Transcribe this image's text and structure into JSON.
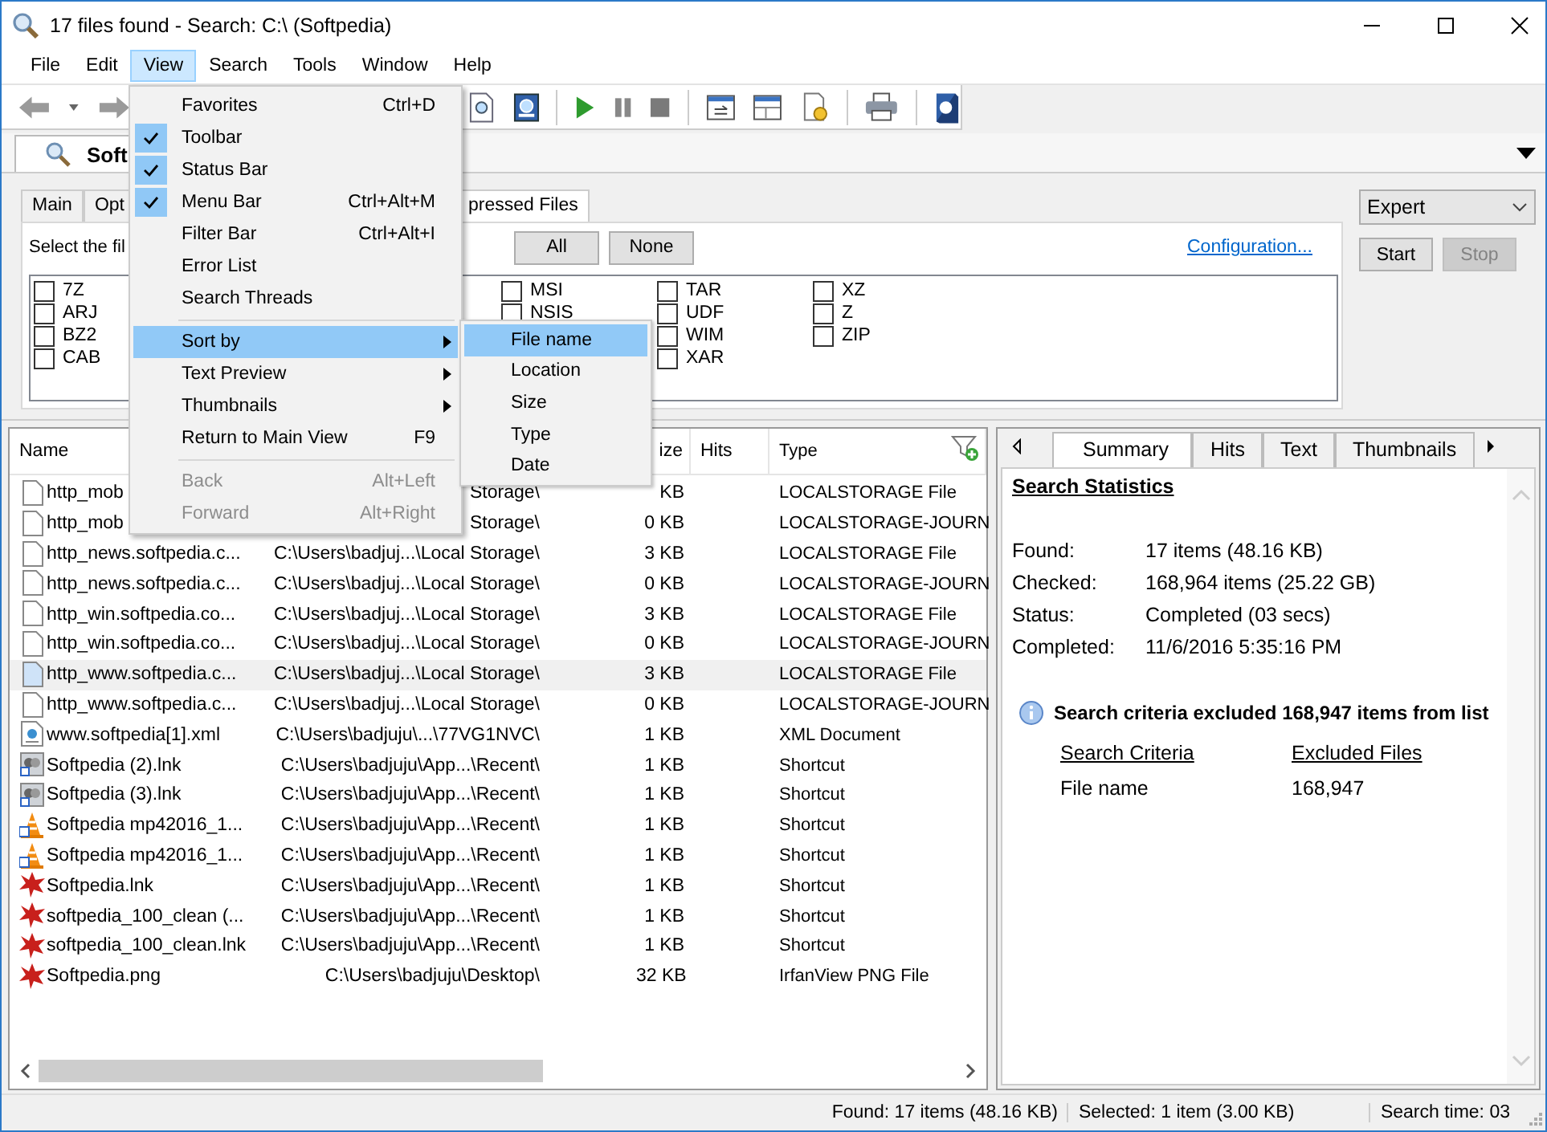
{
  "window": {
    "title": "17 files found - Search: C:\\ (Softpedia)"
  },
  "menubar": [
    {
      "label": "File",
      "selected": false
    },
    {
      "label": "Edit",
      "selected": false
    },
    {
      "label": "View",
      "selected": true
    },
    {
      "label": "Search",
      "selected": false
    },
    {
      "label": "Tools",
      "selected": false
    },
    {
      "label": "Window",
      "selected": false
    },
    {
      "label": "Help",
      "selected": false
    }
  ],
  "view_menu": [
    {
      "kind": "item",
      "label": "Favorites",
      "shortcut": "Ctrl+D",
      "checked": false,
      "submenu": false,
      "selected": false,
      "disabled": false
    },
    {
      "kind": "item",
      "label": "Toolbar",
      "checked": true,
      "submenu": false,
      "selected": false,
      "disabled": false
    },
    {
      "kind": "item",
      "label": "Status Bar",
      "checked": true,
      "submenu": false,
      "selected": false,
      "disabled": false
    },
    {
      "kind": "item",
      "label": "Menu Bar",
      "shortcut": "Ctrl+Alt+M",
      "checked": true,
      "submenu": false,
      "selected": false,
      "disabled": false
    },
    {
      "kind": "item",
      "label": "Filter Bar",
      "shortcut": "Ctrl+Alt+I",
      "checked": false,
      "submenu": false,
      "selected": false,
      "disabled": false
    },
    {
      "kind": "item",
      "label": "Error List",
      "checked": false,
      "submenu": false,
      "selected": false,
      "disabled": false
    },
    {
      "kind": "item",
      "label": "Search Threads",
      "checked": false,
      "submenu": false,
      "selected": false,
      "disabled": false
    },
    {
      "kind": "separator"
    },
    {
      "kind": "item",
      "label": "Sort by",
      "checked": false,
      "submenu": true,
      "selected": true,
      "disabled": false
    },
    {
      "kind": "item",
      "label": "Text Preview",
      "checked": false,
      "submenu": true,
      "selected": false,
      "disabled": false
    },
    {
      "kind": "item",
      "label": "Thumbnails",
      "checked": false,
      "submenu": true,
      "selected": false,
      "disabled": false
    },
    {
      "kind": "item",
      "label": "Return to Main View",
      "shortcut": "F9",
      "checked": false,
      "submenu": false,
      "selected": false,
      "disabled": false
    },
    {
      "kind": "separator"
    },
    {
      "kind": "item",
      "label": "Back",
      "shortcut": "Alt+Left",
      "checked": false,
      "submenu": false,
      "selected": false,
      "disabled": true
    },
    {
      "kind": "item",
      "label": "Forward",
      "shortcut": "Alt+Right",
      "checked": false,
      "submenu": false,
      "selected": false,
      "disabled": true
    }
  ],
  "sort_submenu": [
    {
      "label": "File name",
      "selected": true
    },
    {
      "label": "Location",
      "selected": false
    },
    {
      "label": "Size",
      "selected": false
    },
    {
      "label": "Type",
      "selected": false
    },
    {
      "label": "Date",
      "selected": false
    }
  ],
  "document_tab": {
    "label": "Soft"
  },
  "options": {
    "tabs": [
      {
        "label": "Main",
        "selected": false
      },
      {
        "label": "Opt",
        "selected": false
      },
      {
        "label": "pressed Files",
        "selected": true
      }
    ],
    "instruction": "Select the fil",
    "all_button": "All",
    "none_button": "None",
    "config_link": "Configuration...",
    "checkbox_columns": [
      [
        {
          "label": "7Z",
          "checked": false
        },
        {
          "label": "ARJ",
          "checked": false
        },
        {
          "label": "BZ2",
          "checked": false
        },
        {
          "label": "CAB",
          "checked": false
        }
      ],
      [
        {
          "label": "MSI",
          "checked": false
        },
        {
          "label": "NSIS",
          "checked": false
        }
      ],
      [
        {
          "label": "TAR",
          "checked": false
        },
        {
          "label": "UDF",
          "checked": false
        },
        {
          "label": "WIM",
          "checked": false
        },
        {
          "label": "XAR",
          "checked": false
        }
      ],
      [
        {
          "label": "XZ",
          "checked": false
        },
        {
          "label": "Z",
          "checked": false
        },
        {
          "label": "ZIP",
          "checked": false
        }
      ]
    ],
    "mode": "Expert",
    "start_button": {
      "label": "Start",
      "disabled": false
    },
    "stop_button": {
      "label": "Stop",
      "disabled": true
    }
  },
  "table": {
    "columns": [
      "Name",
      "ize",
      "Hits",
      "Type"
    ],
    "rows": [
      {
        "kind": "document",
        "name": "http_mob",
        "location": "Storage\\",
        "size": "KB",
        "type": "LOCALSTORAGE File",
        "selected": false
      },
      {
        "kind": "document",
        "name": "http_mob",
        "location": "Storage\\",
        "size": "0 KB",
        "type": "LOCALSTORAGE-JOURN",
        "selected": false
      },
      {
        "kind": "document",
        "name": "http_news.softpedia.c...",
        "location": "C:\\Users\\badjuj...\\Local Storage\\",
        "size": "3 KB",
        "type": "LOCALSTORAGE File",
        "selected": false
      },
      {
        "kind": "document",
        "name": "http_news.softpedia.c...",
        "location": "C:\\Users\\badjuj...\\Local Storage\\",
        "size": "0 KB",
        "type": "LOCALSTORAGE-JOURN",
        "selected": false
      },
      {
        "kind": "document",
        "name": "http_win.softpedia.co...",
        "location": "C:\\Users\\badjuj...\\Local Storage\\",
        "size": "3 KB",
        "type": "LOCALSTORAGE File",
        "selected": false
      },
      {
        "kind": "document",
        "name": "http_win.softpedia.co...",
        "location": "C:\\Users\\badjuj...\\Local Storage\\",
        "size": "0 KB",
        "type": "LOCALSTORAGE-JOURN",
        "selected": false
      },
      {
        "kind": "document",
        "name": "http_www.softpedia.c...",
        "location": "C:\\Users\\badjuj...\\Local Storage\\",
        "size": "3 KB",
        "type": "LOCALSTORAGE File",
        "selected": true
      },
      {
        "kind": "document",
        "name": "http_www.softpedia.c...",
        "location": "C:\\Users\\badjuj...\\Local Storage\\",
        "size": "0 KB",
        "type": "LOCALSTORAGE-JOURN",
        "selected": false
      },
      {
        "kind": "xml",
        "name": "www.softpedia[1].xml",
        "location": "C:\\Users\\badjuju\\...\\77VG1NVC\\",
        "size": "1 KB",
        "type": "XML Document",
        "selected": false
      },
      {
        "kind": "shortcut",
        "name": "Softpedia (2).lnk",
        "location": "C:\\Users\\badjuju\\App...\\Recent\\",
        "size": "1 KB",
        "type": "Shortcut",
        "selected": false
      },
      {
        "kind": "shortcut",
        "name": "Softpedia (3).lnk",
        "location": "C:\\Users\\badjuju\\App...\\Recent\\",
        "size": "1 KB",
        "type": "Shortcut",
        "selected": false
      },
      {
        "kind": "media",
        "name": "Softpedia mp42016_1...",
        "location": "C:\\Users\\badjuju\\App...\\Recent\\",
        "size": "1 KB",
        "type": "Shortcut",
        "selected": false
      },
      {
        "kind": "media",
        "name": "Softpedia mp42016_1...",
        "location": "C:\\Users\\badjuju\\App...\\Recent\\",
        "size": "1 KB",
        "type": "Shortcut",
        "selected": false
      },
      {
        "kind": "image",
        "name": "Softpedia.lnk",
        "location": "C:\\Users\\badjuju\\App...\\Recent\\",
        "size": "1 KB",
        "type": "Shortcut",
        "selected": false
      },
      {
        "kind": "image",
        "name": "softpedia_100_clean (...",
        "location": "C:\\Users\\badjuju\\App...\\Recent\\",
        "size": "1 KB",
        "type": "Shortcut",
        "selected": false
      },
      {
        "kind": "image",
        "name": "softpedia_100_clean.lnk",
        "location": "C:\\Users\\badjuju\\App...\\Recent\\",
        "size": "1 KB",
        "type": "Shortcut",
        "selected": false
      },
      {
        "kind": "image",
        "name": "Softpedia.png",
        "location": "C:\\Users\\badjuju\\Desktop\\",
        "size": "32 KB",
        "type": "IrfanView PNG File",
        "selected": false
      }
    ]
  },
  "details": {
    "tabs": [
      {
        "label": "Summary",
        "selected": true
      },
      {
        "label": "Hits",
        "selected": false
      },
      {
        "label": "Text",
        "selected": false
      },
      {
        "label": "Thumbnails",
        "selected": false
      }
    ],
    "heading": "Search Statistics",
    "stats": [
      {
        "label": "Found:",
        "value": "17 items (48.16 KB)"
      },
      {
        "label": "Checked:",
        "value": "168,964 items (25.22 GB)"
      },
      {
        "label": "Status:",
        "value": "Completed (03 secs)"
      },
      {
        "label": "Completed:",
        "value": "11/6/2016 5:35:16 PM"
      }
    ],
    "notice": "Search criteria excluded 168,947 items from list",
    "criteria_headers": [
      "Search Criteria",
      "Excluded Files"
    ],
    "criteria_rows": [
      [
        "File name",
        "168,947"
      ]
    ]
  },
  "status_bar": [
    "Found: 17 items (48.16 KB)",
    "Selected: 1 item (3.00 KB)",
    "Search time: 03"
  ]
}
